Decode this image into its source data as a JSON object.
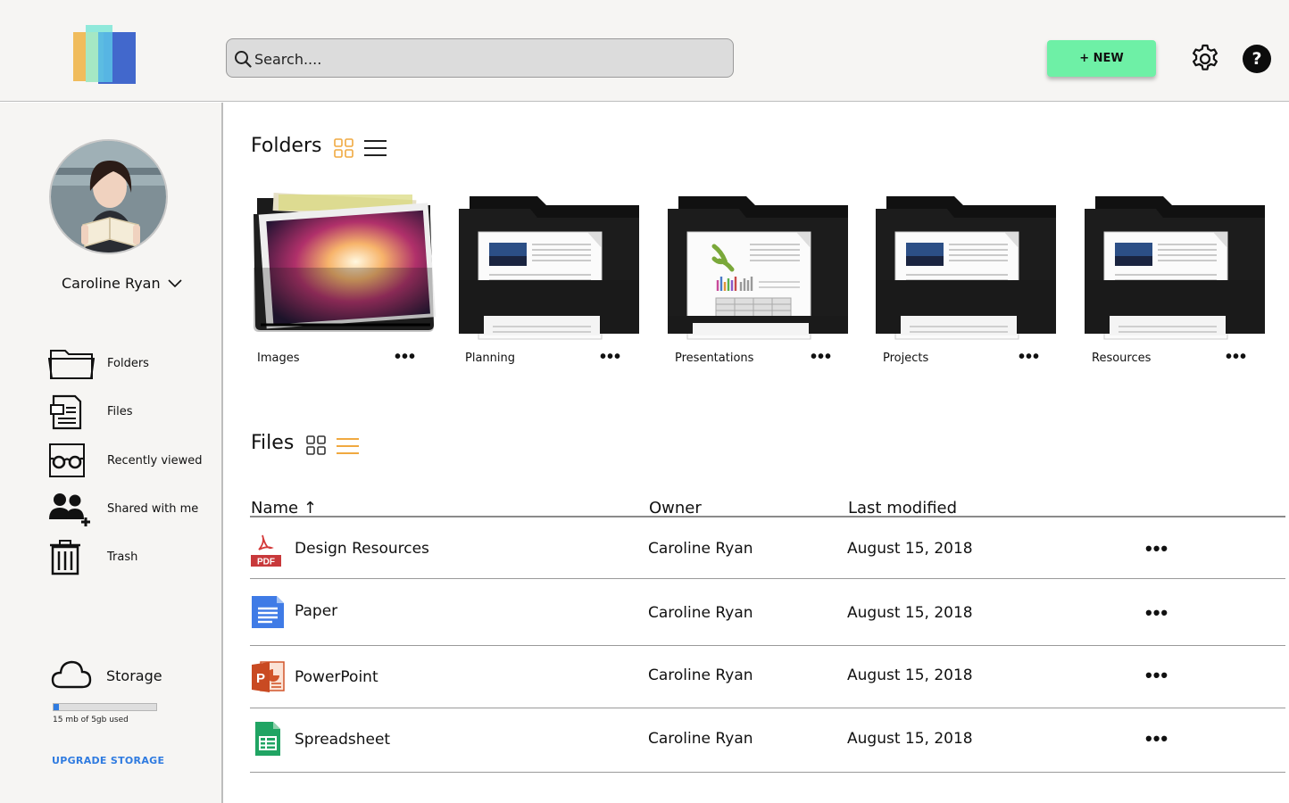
{
  "header": {
    "search_placeholder": "Search....",
    "new_button_label": "+ NEW",
    "help_label": "?",
    "settings_icon": "gear-icon",
    "accent_color": "#6ef0a6"
  },
  "sidebar": {
    "user_name": "Caroline Ryan",
    "nav": [
      {
        "label": "Folders",
        "icon": "folder-icon"
      },
      {
        "label": "Files",
        "icon": "file-icon"
      },
      {
        "label": "Recently viewed",
        "icon": "glasses-icon"
      },
      {
        "label": "Shared with me",
        "icon": "shared-users-icon"
      },
      {
        "label": "Trash",
        "icon": "trash-icon"
      }
    ],
    "storage_label": "Storage",
    "storage_used_text": "15 mb of 5gb used",
    "storage_used_fraction": 0.05,
    "upgrade_label": "UPGRADE STORAGE",
    "link_color": "#2f7be0"
  },
  "folders": {
    "title": "Folders",
    "more_label": "•••",
    "items": [
      {
        "name": "Images"
      },
      {
        "name": "Planning"
      },
      {
        "name": "Presentations"
      },
      {
        "name": "Projects"
      },
      {
        "name": "Resources"
      }
    ]
  },
  "files": {
    "title": "Files",
    "more_label": "•••",
    "columns": {
      "name": "Name ↑",
      "owner": "Owner",
      "modified": "Last modified"
    },
    "rows": [
      {
        "name": "Design Resources",
        "type": "pdf",
        "icon": "pdf-icon",
        "owner": "Caroline Ryan",
        "modified": "August 15, 2018"
      },
      {
        "name": "Paper",
        "type": "doc",
        "icon": "doc-icon",
        "owner": "Caroline Ryan",
        "modified": "August 15, 2018"
      },
      {
        "name": "PowerPoint",
        "type": "ppt",
        "icon": "powerpoint-icon",
        "owner": "Caroline Ryan",
        "modified": "August 15, 2018"
      },
      {
        "name": "Spreadsheet",
        "type": "sheet",
        "icon": "spreadsheet-icon",
        "owner": "Caroline Ryan",
        "modified": "August 15, 2018"
      }
    ]
  }
}
